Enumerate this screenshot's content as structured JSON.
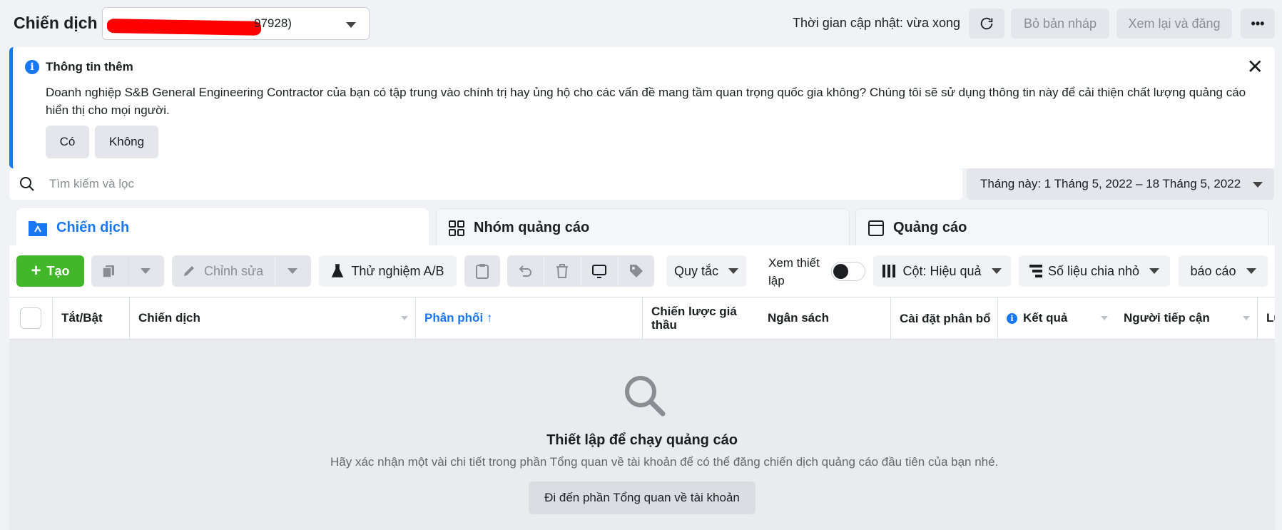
{
  "header": {
    "title": "Chiến dịch",
    "account_visible_text": "97928)",
    "update_status": "Thời gian cập nhật: vừa xong",
    "discard_label": "Bỏ bản nháp",
    "review_publish_label": "Xem lại và đăng"
  },
  "info_banner": {
    "title": "Thông tin thêm",
    "body": "Doanh nghiệp S&B General Engineering Contractor của bạn có tập trung vào chính trị hay ủng hộ cho các vấn đề mang tầm quan trọng quốc gia không? Chúng tôi sẽ sử dụng thông tin này để cải thiện chất lượng quảng cáo hiển thị cho mọi người.",
    "yes_label": "Có",
    "no_label": "Không"
  },
  "search": {
    "placeholder": "Tìm kiếm và lọc"
  },
  "date_range": {
    "label": "Tháng này: 1 Tháng 5, 2022 – 18 Tháng 5, 2022"
  },
  "tabs": [
    {
      "label": "Chiến dịch",
      "active": true
    },
    {
      "label": "Nhóm quảng cáo",
      "active": false
    },
    {
      "label": "Quảng cáo",
      "active": false
    }
  ],
  "toolbar": {
    "create_label": "Tạo",
    "edit_label": "Chỉnh sửa",
    "ab_test_label": "Thử nghiệm A/B",
    "rules_label": "Quy tắc",
    "view_setup_label": "Xem thiết lập",
    "columns_label": "Cột: Hiệu quả",
    "breakdown_label": "Số liệu chia nhỏ",
    "reports_label": "báo cáo"
  },
  "table": {
    "columns": [
      "Tắt/Bật",
      "Chiến dịch",
      "Phân phối ↑",
      "Chiến lược giá thầu",
      "Ngân sách",
      "Cài đặt phân bổ",
      "Kết quả",
      "Người tiếp cận",
      "Lượ"
    ]
  },
  "empty_state": {
    "title": "Thiết lập để chạy quảng cáo",
    "subtitle": "Hãy xác nhận một vài chi tiết trong phần Tổng quan về tài khoản để có thể đăng chiến dịch quảng cáo đầu tiên của bạn nhé.",
    "button_label": "Đi đến phần Tổng quan về tài khoản"
  },
  "colors": {
    "accent": "#1877f2",
    "create_green": "#42b72a",
    "redaction": "#ff0000"
  }
}
